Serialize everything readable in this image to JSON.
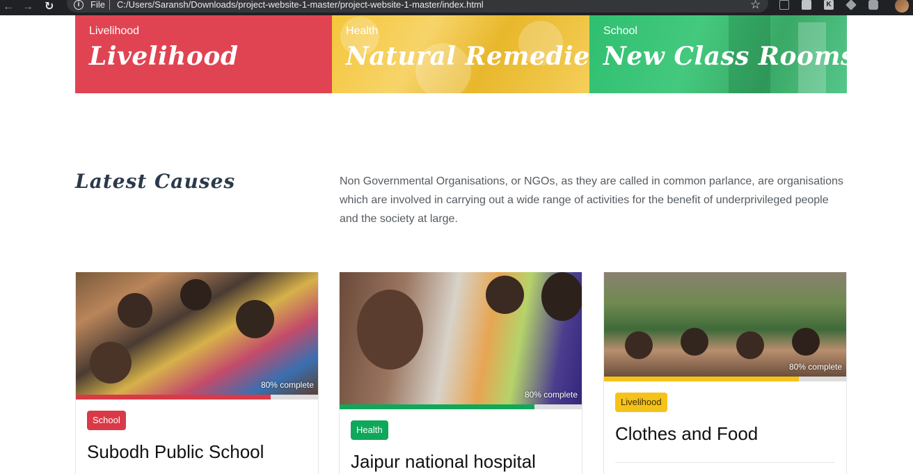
{
  "browser": {
    "file_label": "File",
    "url": "C:/Users/Saransh/Downloads/project-website-1-master/project-website-1-master/index.html",
    "icons": [
      "back-icon",
      "forward-icon",
      "reload-icon",
      "info-icon",
      "star-icon",
      "extension-icons",
      "profile-avatar"
    ]
  },
  "categories": [
    {
      "small": "Livelihood",
      "big": "Livelihood",
      "color": "#e04452"
    },
    {
      "small": "Health",
      "big": "Natural Remedies",
      "color": "#f4c63a"
    },
    {
      "small": "School",
      "big": "New Class Rooms",
      "color": "#2fbf70"
    }
  ],
  "section": {
    "title": "Latest Causes",
    "description": "Non Governmental Organisations, or NGOs, as they are called in common parlance, are organisations which are involved in carrying out a wide range of activities for the benefit of underprivileged people and the society at large."
  },
  "causes": [
    {
      "progress_text": "80% complete",
      "progress": 0.8,
      "badge": "School",
      "title": "Subodh Public School",
      "accent": "#d93a48"
    },
    {
      "progress_text": "80% complete",
      "progress": 0.8,
      "badge": "Health",
      "title": "Jaipur national hospital",
      "accent": "#0fa85a"
    },
    {
      "progress_text": "80% complete",
      "progress": 0.8,
      "badge": "Livelihood",
      "title": "Clothes and Food",
      "accent": "#f5c21a"
    }
  ]
}
